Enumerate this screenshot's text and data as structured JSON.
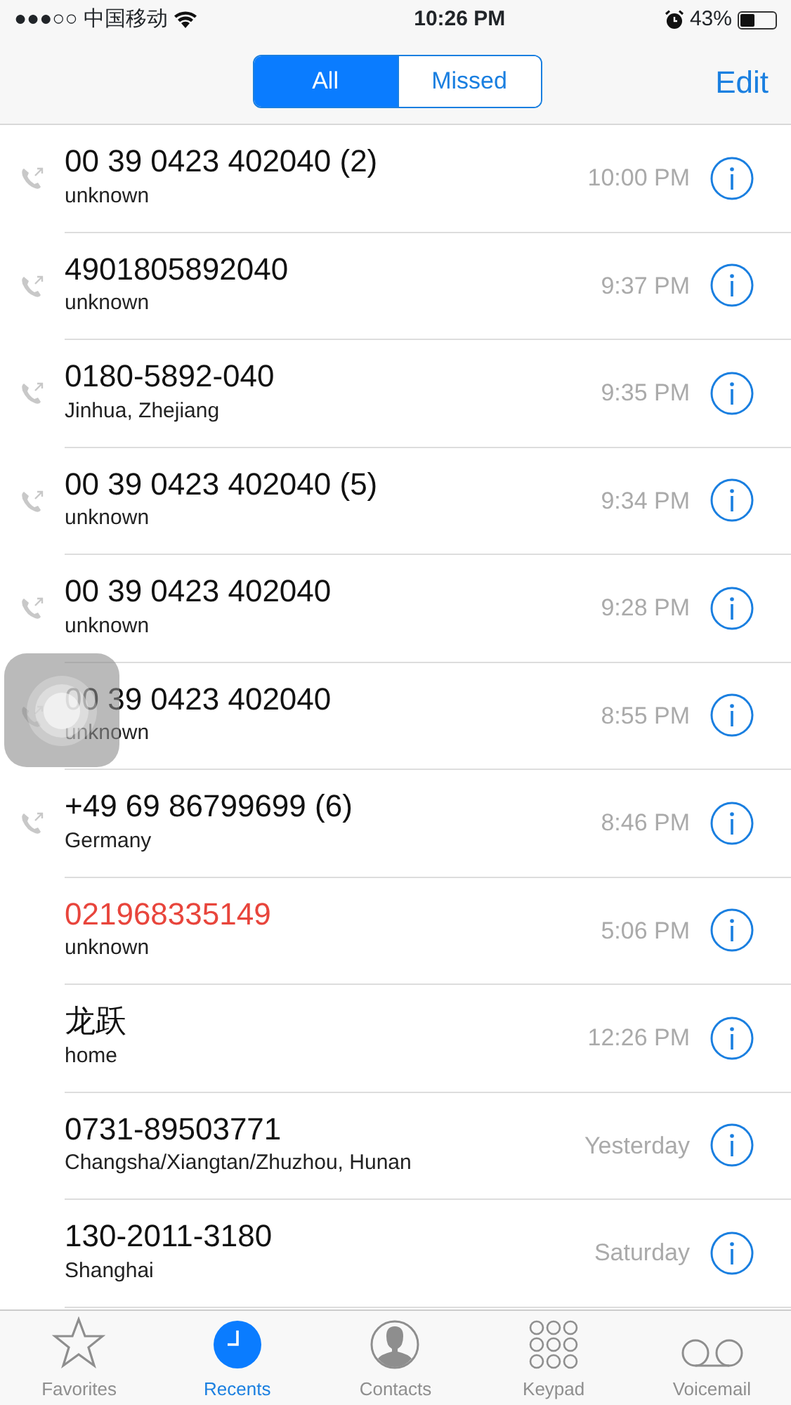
{
  "status_bar": {
    "signal": "●●●○○",
    "carrier": "中国移动",
    "time": "10:26 PM",
    "battery_text": "43%"
  },
  "segments": [
    {
      "label": "All",
      "selected": true
    },
    {
      "label": "Missed",
      "selected": false
    }
  ],
  "edit_button": "Edit",
  "calls": [
    {
      "number": "00 39 0423 402040  (2)",
      "detail": "unknown",
      "time": "10:00 PM",
      "outgoing": true,
      "missed": false
    },
    {
      "number": "4901805892040",
      "detail": "unknown",
      "time": "9:37 PM",
      "outgoing": true,
      "missed": false
    },
    {
      "number": "0180-5892-040",
      "detail": "Jinhua, Zhejiang",
      "time": "9:35 PM",
      "outgoing": true,
      "missed": false
    },
    {
      "number": "00 39 0423 402040  (5)",
      "detail": "unknown",
      "time": "9:34 PM",
      "outgoing": true,
      "missed": false
    },
    {
      "number": "00 39 0423 402040",
      "detail": "unknown",
      "time": "9:28 PM",
      "outgoing": true,
      "missed": false
    },
    {
      "number": "00 39 0423 402040",
      "detail": "unknown",
      "time": "8:55 PM",
      "outgoing": true,
      "missed": false
    },
    {
      "number": "+49 69 86799699  (6)",
      "detail": "Germany",
      "time": "8:46 PM",
      "outgoing": true,
      "missed": false
    },
    {
      "number": "021968335149",
      "detail": "unknown",
      "time": "5:06 PM",
      "outgoing": false,
      "missed": true
    },
    {
      "number": "龙跃",
      "detail": "home",
      "time": "12:26 PM",
      "outgoing": false,
      "missed": false
    },
    {
      "number": "0731-89503771",
      "detail": "Changsha/Xiangtan/Zhuzhou, Hunan",
      "time": "Yesterday",
      "outgoing": false,
      "missed": false
    },
    {
      "number": "130-2011-3180",
      "detail": "Shanghai",
      "time": "Saturday",
      "outgoing": false,
      "missed": false
    }
  ],
  "tab_bar": [
    {
      "label": "Favorites",
      "kind": "star",
      "selected": false
    },
    {
      "label": "Recents",
      "kind": "clock",
      "selected": true
    },
    {
      "label": "Contacts",
      "kind": "person",
      "selected": false
    },
    {
      "label": "Keypad",
      "kind": "keypad",
      "selected": false
    },
    {
      "label": "Voicemail",
      "kind": "voicemail",
      "selected": false
    }
  ]
}
